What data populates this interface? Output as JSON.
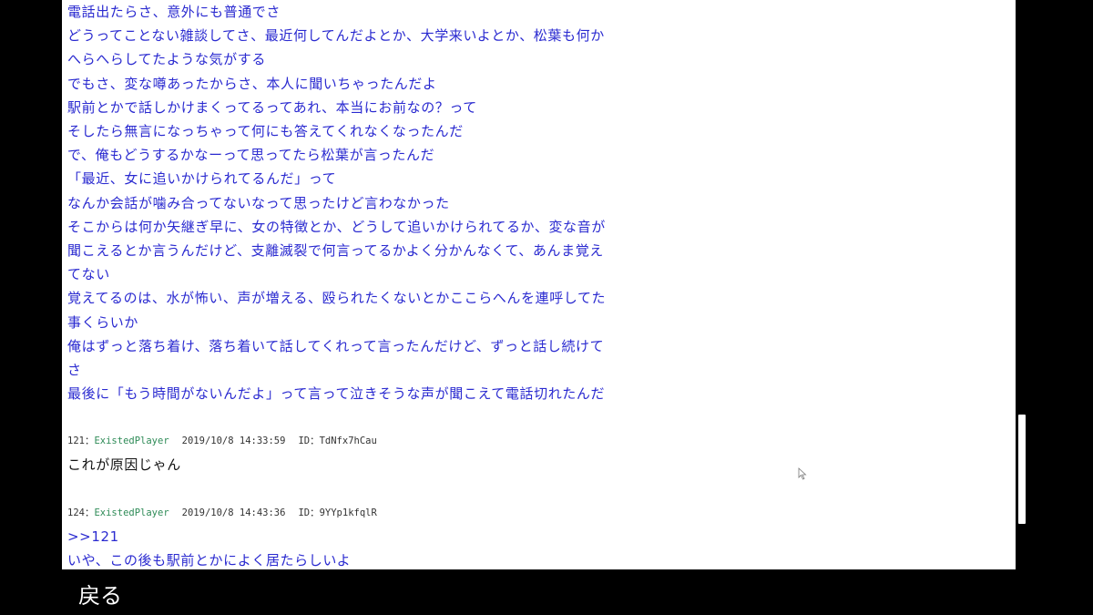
{
  "post_body_lines": [
    "電話出たらさ、意外にも普通でさ",
    "どうってことない雑談してさ、最近何してんだよとか、大学来いよとか、松葉も何か",
    "へらへらしてたような気がする",
    "でもさ、変な噂あったからさ、本人に聞いちゃったんだよ",
    "駅前とかで話しかけまくってるってあれ、本当にお前なの？って",
    "そしたら無言になっちゃって何にも答えてくれなくなったんだ",
    "で、俺もどうするかなーって思ってたら松葉が言ったんだ",
    "「最近、女に追いかけられてるんだ」って",
    "なんか会話が噛み合ってないなって思ったけど言わなかった",
    "そこからは何か矢継ぎ早に、女の特徴とか、どうして追いかけられてるか、変な音が",
    "聞こえるとか言うんだけど、支離滅裂で何言ってるかよく分かんなくて、あんま覚え",
    "てない",
    "覚えてるのは、水が怖い、声が増える、殴られたくないとかここらへんを連呼してた",
    "事くらいか",
    "俺はずっと落ち着け、落ち着いて話してくれって言ったんだけど、ずっと話し続けて",
    "さ",
    "最後に「もう時間がないんだよ」って言って泣きそうな声が聞こえて電話切れたんだ"
  ],
  "posts": [
    {
      "number": "121",
      "separator": "：",
      "name": "ExistedPlayer",
      "date": "2019/10/8 14:33:59",
      "id": "ID：TdNfx7hCau",
      "body": "これが原因じゃん"
    },
    {
      "number": "124",
      "separator": "：",
      "name": "ExistedPlayer",
      "date": "2019/10/8 14:43:36",
      "id": "ID：9YYp1kfqlR",
      "anchor": ">>121",
      "body": "いや、この後も駅前とかによく居たらしいよ"
    }
  ],
  "footer": {
    "back_label": "戻る"
  },
  "colors": {
    "body_text": "#2a2ad0",
    "reply_text": "#111111",
    "name_text": "#2e8b57",
    "background": "#ffffff"
  }
}
